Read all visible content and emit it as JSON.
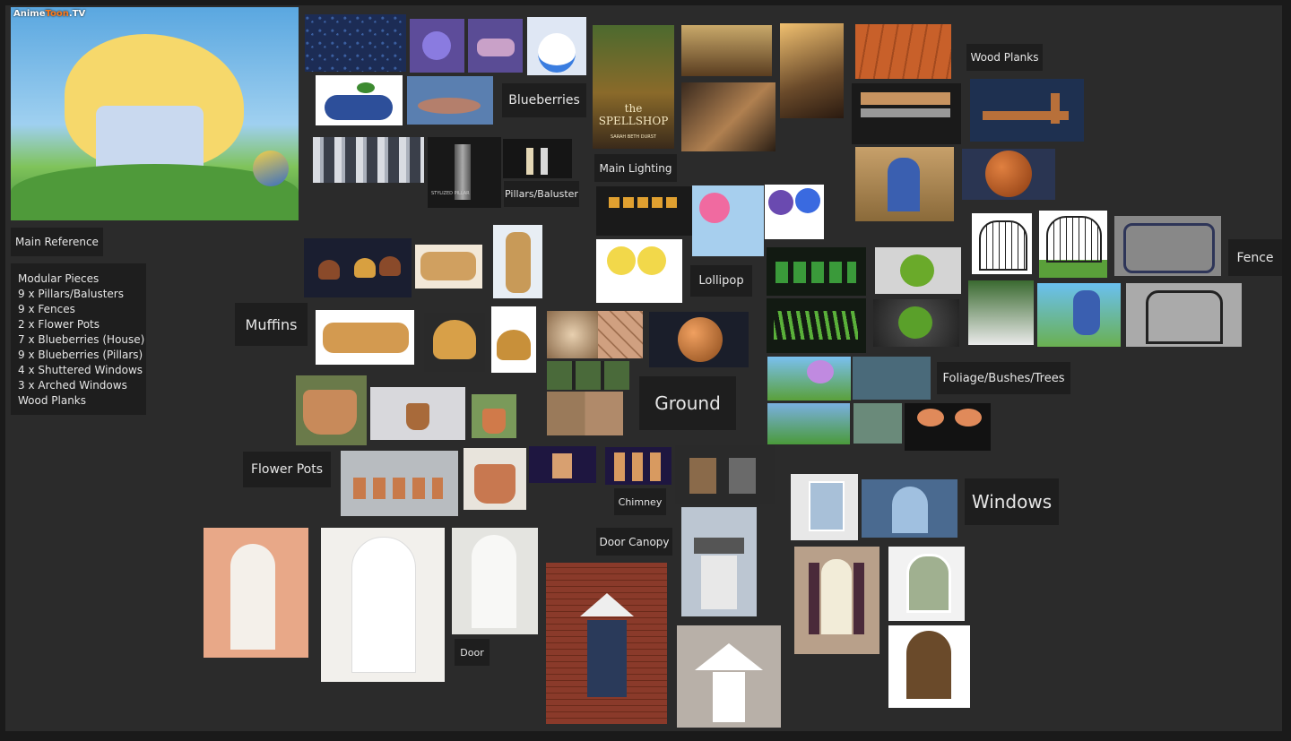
{
  "labels": {
    "main_reference": "Main Reference",
    "blueberries": "Blueberries",
    "pillars": "Pillars/Baluster",
    "main_lighting": "Main Lighting",
    "wood_planks": "Wood Planks",
    "fence": "Fence",
    "lollipop": "Lollipop",
    "muffins": "Muffins",
    "ground": "Ground",
    "foliage": "Foliage/Bushes/Trees",
    "flower_pots": "Flower Pots",
    "chimney": "Chimney",
    "door_canopy": "Door Canopy",
    "windows": "Windows",
    "door": "Door"
  },
  "notes": [
    "Modular Pieces",
    "9 x Pillars/Balusters",
    "9 x Fences",
    "2 x Flower Pots",
    "7 x Blueberries (House)",
    "9 x Blueberries (Pillars)",
    "4 x Shuttered Windows",
    "3 x Arched Windows",
    "Wood Planks"
  ],
  "watermark": {
    "a": "Anime",
    "b": "Toon",
    "c": ".TV"
  },
  "book": {
    "title": "the SPELLSHOP",
    "author": "SARAH BETH DURST"
  },
  "pillar_card_title": "STYLIZED PILLAR"
}
